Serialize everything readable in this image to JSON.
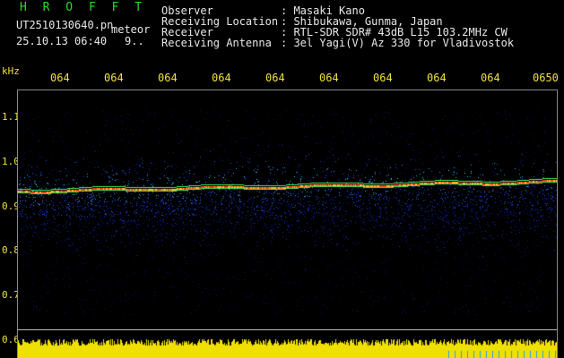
{
  "header": {
    "title": "H R O F F T",
    "file_name": "UT2510130640.pn",
    "meteor_label": "meteor",
    "date_time": "25.10.13 06:40",
    "count": "9.."
  },
  "meta": {
    "labels": [
      "Observer",
      "Receiving Location",
      "Receiver",
      "Receiving Antenna"
    ],
    "values": [
      ": Masaki Kano",
      ": Shibukawa, Gunma, Japan",
      ": RTL-SDR SDR# 43dB L15 103.2MHz CW",
      ": 3el Yagi(V) Az 330 for Vladivostok"
    ]
  },
  "axis": {
    "unit": "kHz",
    "time_ticks": [
      "064",
      "064",
      "064",
      "064",
      "064",
      "064",
      "064",
      "064",
      "064",
      "0650"
    ],
    "freq_ticks": [
      "1.1",
      "1.0",
      "0.9",
      "0.8",
      "0.7",
      "0.6"
    ]
  },
  "colors": {
    "background": "#000000",
    "title": "#2fd82f",
    "text": "#e8e8e8",
    "axis": "#f0e040",
    "signal_trace": "#ff3020",
    "noise_band": "#1030d0",
    "level_bar": "#f0e000"
  }
}
